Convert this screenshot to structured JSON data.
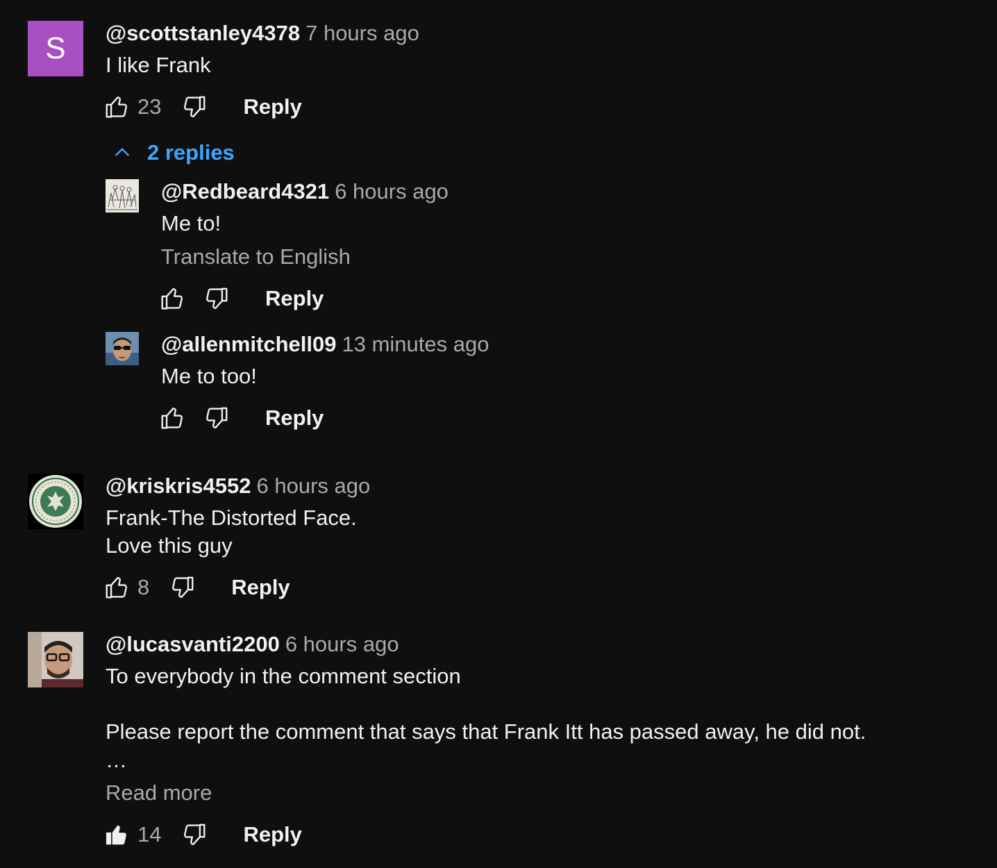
{
  "colors": {
    "background": "#0f0f0f",
    "text": "#f1f1f1",
    "muted": "#aaaaaa",
    "link": "#3ea6ff",
    "avatar_s": "#a94fc4"
  },
  "comments": [
    {
      "avatar": {
        "type": "letter",
        "letter": "S"
      },
      "author": "@scottstanley4378",
      "time": "7 hours ago",
      "text": "I like Frank",
      "likes": "23",
      "reply_label": "Reply",
      "replies_toggle": "2 replies",
      "replies": [
        {
          "avatar": {
            "type": "image",
            "icon": "sketch-drawing-avatar"
          },
          "author": "@Redbeard4321",
          "time": "6 hours ago",
          "text": "Me to!",
          "translate_label": "Translate to English",
          "reply_label": "Reply"
        },
        {
          "avatar": {
            "type": "image",
            "icon": "sunglasses-man-avatar"
          },
          "author": "@allenmitchell09",
          "time": "13 minutes ago",
          "text": "Me to too!",
          "reply_label": "Reply"
        }
      ]
    },
    {
      "avatar": {
        "type": "image",
        "icon": "green-seal-avatar"
      },
      "author": "@kriskris4552",
      "time": "6 hours ago",
      "text_lines": [
        "Frank-The Distorted Face.",
        "Love this guy"
      ],
      "likes": "8",
      "reply_label": "Reply"
    },
    {
      "avatar": {
        "type": "image",
        "icon": "glasses-man-avatar"
      },
      "author": "@lucasvanti2200",
      "time": "6 hours ago",
      "text_lines": [
        "To everybody in the comment section",
        "Please report the comment that says that Frank Itt has passed away, he did not.",
        "…"
      ],
      "read_more": "Read more",
      "likes": "14",
      "liked": true,
      "reply_label": "Reply"
    }
  ]
}
